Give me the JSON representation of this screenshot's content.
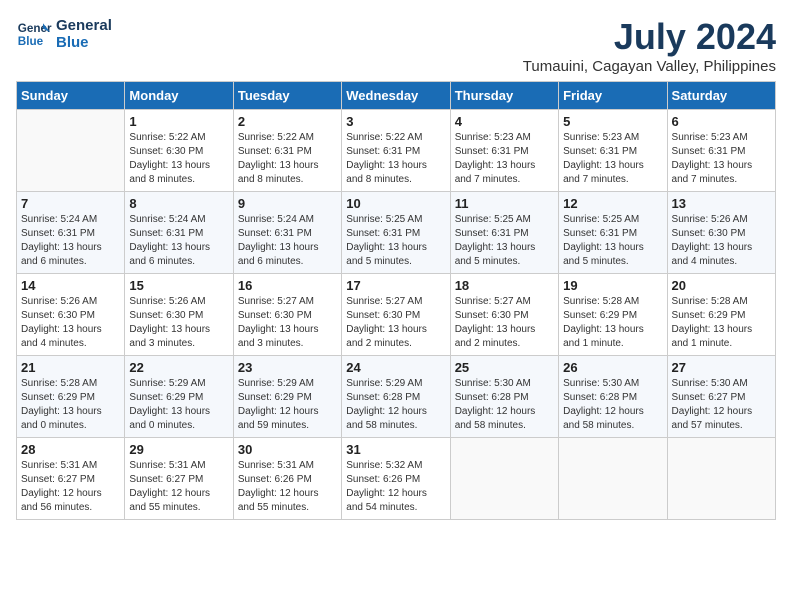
{
  "logo": {
    "line1": "General",
    "line2": "Blue"
  },
  "title": "July 2024",
  "subtitle": "Tumauini, Cagayan Valley, Philippines",
  "days_of_week": [
    "Sunday",
    "Monday",
    "Tuesday",
    "Wednesday",
    "Thursday",
    "Friday",
    "Saturday"
  ],
  "weeks": [
    [
      {
        "num": "",
        "detail": ""
      },
      {
        "num": "1",
        "detail": "Sunrise: 5:22 AM\nSunset: 6:30 PM\nDaylight: 13 hours\nand 8 minutes."
      },
      {
        "num": "2",
        "detail": "Sunrise: 5:22 AM\nSunset: 6:31 PM\nDaylight: 13 hours\nand 8 minutes."
      },
      {
        "num": "3",
        "detail": "Sunrise: 5:22 AM\nSunset: 6:31 PM\nDaylight: 13 hours\nand 8 minutes."
      },
      {
        "num": "4",
        "detail": "Sunrise: 5:23 AM\nSunset: 6:31 PM\nDaylight: 13 hours\nand 7 minutes."
      },
      {
        "num": "5",
        "detail": "Sunrise: 5:23 AM\nSunset: 6:31 PM\nDaylight: 13 hours\nand 7 minutes."
      },
      {
        "num": "6",
        "detail": "Sunrise: 5:23 AM\nSunset: 6:31 PM\nDaylight: 13 hours\nand 7 minutes."
      }
    ],
    [
      {
        "num": "7",
        "detail": "Sunrise: 5:24 AM\nSunset: 6:31 PM\nDaylight: 13 hours\nand 6 minutes."
      },
      {
        "num": "8",
        "detail": "Sunrise: 5:24 AM\nSunset: 6:31 PM\nDaylight: 13 hours\nand 6 minutes."
      },
      {
        "num": "9",
        "detail": "Sunrise: 5:24 AM\nSunset: 6:31 PM\nDaylight: 13 hours\nand 6 minutes."
      },
      {
        "num": "10",
        "detail": "Sunrise: 5:25 AM\nSunset: 6:31 PM\nDaylight: 13 hours\nand 5 minutes."
      },
      {
        "num": "11",
        "detail": "Sunrise: 5:25 AM\nSunset: 6:31 PM\nDaylight: 13 hours\nand 5 minutes."
      },
      {
        "num": "12",
        "detail": "Sunrise: 5:25 AM\nSunset: 6:31 PM\nDaylight: 13 hours\nand 5 minutes."
      },
      {
        "num": "13",
        "detail": "Sunrise: 5:26 AM\nSunset: 6:30 PM\nDaylight: 13 hours\nand 4 minutes."
      }
    ],
    [
      {
        "num": "14",
        "detail": "Sunrise: 5:26 AM\nSunset: 6:30 PM\nDaylight: 13 hours\nand 4 minutes."
      },
      {
        "num": "15",
        "detail": "Sunrise: 5:26 AM\nSunset: 6:30 PM\nDaylight: 13 hours\nand 3 minutes."
      },
      {
        "num": "16",
        "detail": "Sunrise: 5:27 AM\nSunset: 6:30 PM\nDaylight: 13 hours\nand 3 minutes."
      },
      {
        "num": "17",
        "detail": "Sunrise: 5:27 AM\nSunset: 6:30 PM\nDaylight: 13 hours\nand 2 minutes."
      },
      {
        "num": "18",
        "detail": "Sunrise: 5:27 AM\nSunset: 6:30 PM\nDaylight: 13 hours\nand 2 minutes."
      },
      {
        "num": "19",
        "detail": "Sunrise: 5:28 AM\nSunset: 6:29 PM\nDaylight: 13 hours\nand 1 minute."
      },
      {
        "num": "20",
        "detail": "Sunrise: 5:28 AM\nSunset: 6:29 PM\nDaylight: 13 hours\nand 1 minute."
      }
    ],
    [
      {
        "num": "21",
        "detail": "Sunrise: 5:28 AM\nSunset: 6:29 PM\nDaylight: 13 hours\nand 0 minutes."
      },
      {
        "num": "22",
        "detail": "Sunrise: 5:29 AM\nSunset: 6:29 PM\nDaylight: 13 hours\nand 0 minutes."
      },
      {
        "num": "23",
        "detail": "Sunrise: 5:29 AM\nSunset: 6:29 PM\nDaylight: 12 hours\nand 59 minutes."
      },
      {
        "num": "24",
        "detail": "Sunrise: 5:29 AM\nSunset: 6:28 PM\nDaylight: 12 hours\nand 58 minutes."
      },
      {
        "num": "25",
        "detail": "Sunrise: 5:30 AM\nSunset: 6:28 PM\nDaylight: 12 hours\nand 58 minutes."
      },
      {
        "num": "26",
        "detail": "Sunrise: 5:30 AM\nSunset: 6:28 PM\nDaylight: 12 hours\nand 58 minutes."
      },
      {
        "num": "27",
        "detail": "Sunrise: 5:30 AM\nSunset: 6:27 PM\nDaylight: 12 hours\nand 57 minutes."
      }
    ],
    [
      {
        "num": "28",
        "detail": "Sunrise: 5:31 AM\nSunset: 6:27 PM\nDaylight: 12 hours\nand 56 minutes."
      },
      {
        "num": "29",
        "detail": "Sunrise: 5:31 AM\nSunset: 6:27 PM\nDaylight: 12 hours\nand 55 minutes."
      },
      {
        "num": "30",
        "detail": "Sunrise: 5:31 AM\nSunset: 6:26 PM\nDaylight: 12 hours\nand 55 minutes."
      },
      {
        "num": "31",
        "detail": "Sunrise: 5:32 AM\nSunset: 6:26 PM\nDaylight: 12 hours\nand 54 minutes."
      },
      {
        "num": "",
        "detail": ""
      },
      {
        "num": "",
        "detail": ""
      },
      {
        "num": "",
        "detail": ""
      }
    ]
  ]
}
